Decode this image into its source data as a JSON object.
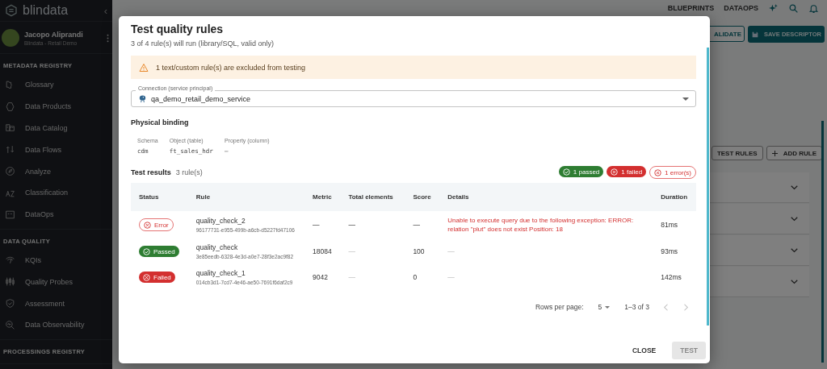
{
  "sidebar": {
    "logo": "blindata",
    "collapse": "‹",
    "user": {
      "name": "Jacopo Aliprandi",
      "org": "Blindata - Retail Demo"
    },
    "sections": [
      {
        "title": "METADATA REGISTRY",
        "items": [
          "Glossary",
          "Data Products",
          "Data Catalog",
          "Data Flows",
          "Analyze",
          "Classification",
          "DataOps"
        ]
      },
      {
        "title": "DATA QUALITY",
        "items": [
          "KQIs",
          "Quality Probes",
          "Assessment",
          "Data Observability"
        ]
      },
      {
        "title": "PROCESSINGS REGISTRY"
      }
    ]
  },
  "background": {
    "nav": [
      "BLUEPRINTS",
      "DATAOPS"
    ],
    "validate": "ALIDATE",
    "save": "SAVE DESCRIPTOR",
    "test_rules": "TEST RULES",
    "add_rule": "ADD RULE"
  },
  "dialog": {
    "title": "Test quality rules",
    "subtitle": "3 of 4 rule(s) will run (library/SQL, valid only)",
    "warning": "1 text/custom rule(s) are excluded from testing",
    "connection": {
      "label": "Connection (service principal)",
      "value": "qa_demo_retail_demo_service"
    },
    "binding": {
      "title": "Physical binding",
      "fields": [
        {
          "label": "Schema",
          "value": "cdm"
        },
        {
          "label": "Object (table)",
          "value": "ft_sales_hdr"
        },
        {
          "label": "Property (column)",
          "value": "–"
        }
      ]
    },
    "results": {
      "title": "Test results",
      "count": "3 rule(s)",
      "chips": [
        {
          "kind": "passed",
          "label": "1 passed"
        },
        {
          "kind": "failed",
          "label": "1 failed"
        },
        {
          "kind": "error",
          "label": "1 error(s)"
        }
      ]
    },
    "table": {
      "columns": [
        "Status",
        "Rule",
        "Metric",
        "Total elements",
        "Score",
        "Details",
        "Duration"
      ],
      "rows": [
        {
          "kind": "error",
          "status": "Error",
          "rule": "quality_check_2",
          "id": "96177731-e955-499b-a6cb-d5227fd47106",
          "metric": "—",
          "total": "—",
          "score": "—",
          "details": "Unable to execute query due to the following exception: ERROR: relation \"plut\" does not exist Position: 18",
          "duration": "81ms"
        },
        {
          "kind": "passed",
          "status": "Passed",
          "rule": "quality_check",
          "id": "3e85eedb-6328-4e3d-a0e7-28f3e2ac9f82",
          "metric": "18084",
          "total": "—",
          "score": "100",
          "details": "—",
          "duration": "93ms"
        },
        {
          "kind": "failed",
          "status": "Failed",
          "rule": "quality_check_1",
          "id": "014cb3d1-7cd7-4e46-ae50-7691f6daf2c9",
          "metric": "9042",
          "total": "—",
          "score": "0",
          "details": "—",
          "duration": "142ms"
        }
      ]
    },
    "pagination": {
      "label": "Rows per page:",
      "per_page": "5",
      "range": "1–3 of 3"
    },
    "buttons": [
      {
        "label": "CLOSE",
        "disabled": false
      },
      {
        "label": "TEST",
        "disabled": true
      }
    ]
  }
}
